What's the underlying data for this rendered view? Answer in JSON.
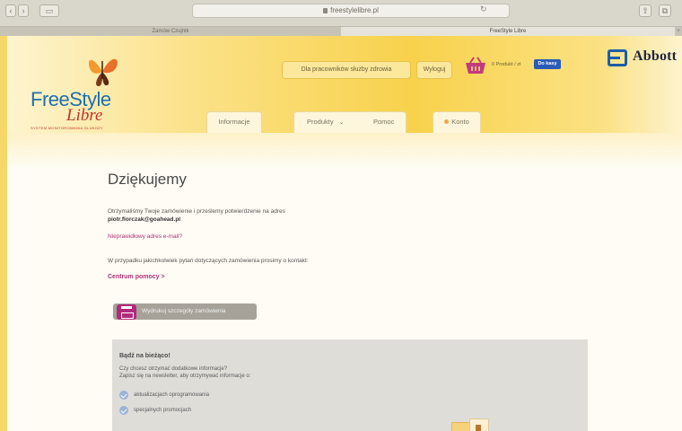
{
  "browser": {
    "url": "freestylelibre.pl",
    "tabs": [
      {
        "label": "Zamów Czujnik",
        "active": false
      },
      {
        "label": "FreeStyle Libre",
        "active": true
      }
    ]
  },
  "header": {
    "logo": {
      "line1": "FreeStyle",
      "line2": "Libre",
      "tagline": "SYSTEM MONITOROWANIA GLUKOZY"
    },
    "professionals_label": "Dla pracowników służby zdrowia",
    "logout_label": "Wyloguj",
    "cart_text": "0 Produkt / zł",
    "checkout_label": "Do kasy",
    "brand": "Abbott"
  },
  "nav": {
    "tabs": [
      {
        "label": "Informacje"
      },
      {
        "label": "Produkty"
      },
      {
        "label": "Pomoc"
      },
      {
        "label": "Konto"
      }
    ]
  },
  "main": {
    "title": "Dziękujemy",
    "confirmation_text": "Otrzymaliśmy Twoje zamówienie i prześlemy potwierdzenie na adres",
    "email": "piotr.florczak@goahead.pl",
    "wrong_email_link": "Nieprawidłowy adres e-mail?",
    "questions_text": "W przypadku jakichkolwiek pytań dotyczących zamówienia prosimy o kontakt:",
    "help_center_link": "Centrum pomocy >",
    "print_label": "Wydrukuj szczegóły zamówienia"
  },
  "newsletter": {
    "title": "Bądź na bieżąco!",
    "line1": "Czy chcesz otrzymać dodatkowe informacje?",
    "line2": "Zapisz się na newsletter, aby otrzymywać informacje o:",
    "items": [
      "aktualizacjach oprogramowania",
      "specjalnych promocjach"
    ]
  },
  "colors": {
    "accent_magenta": "#b0307a",
    "header_yellow": "#f8d24c",
    "logo_blue": "#1f6eaf",
    "logo_red": "#c0302b",
    "checkout_blue": "#2a5bb5"
  }
}
